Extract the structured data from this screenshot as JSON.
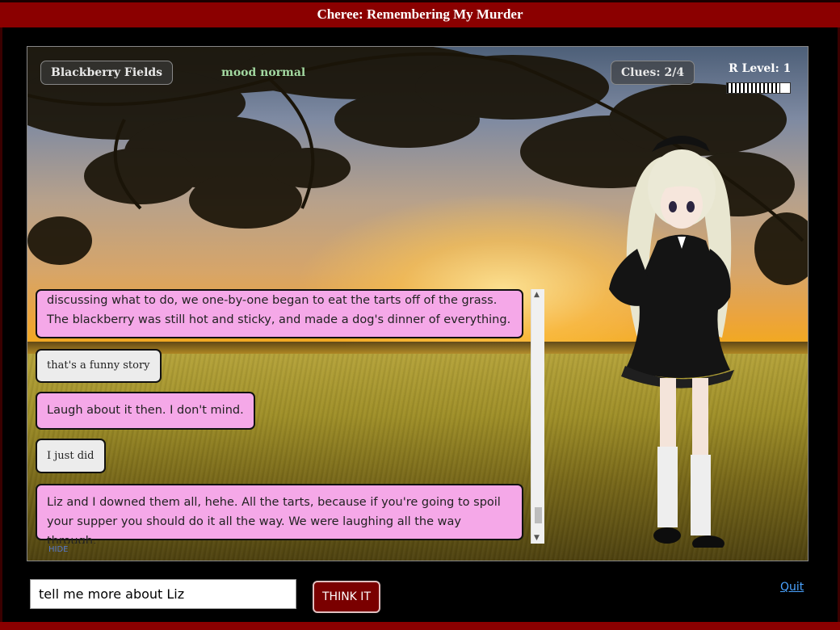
{
  "window": {
    "title": "Cheree: Remembering My Murder"
  },
  "scene": {
    "location": "Blackberry Fields",
    "mood": "mood normal",
    "clues_label": "Clues:",
    "clues_value": "2/4",
    "r_level_label": "R Level:",
    "r_level_value": "1",
    "r_level_meter_fraction": 0.84
  },
  "chat": {
    "messages": [
      {
        "from": "cheree",
        "text": "discussing what to do, we one-by-one began to eat the tarts off of the grass. The blackberry was still hot and sticky, and made a dog's dinner of everything."
      },
      {
        "from": "player",
        "text": "that's a funny story"
      },
      {
        "from": "cheree",
        "text": "Laugh about it then. I don't mind."
      },
      {
        "from": "player",
        "text": "I just did"
      },
      {
        "from": "cheree",
        "text": "Liz and I downed them all, hehe. All the tarts, because if you're going to spoil your supper you should do it all the way. We were laughing all the way through."
      }
    ],
    "hide_label": "HIDE",
    "scroll_up": "▲",
    "scroll_down": "▼"
  },
  "input": {
    "value": "tell me more about Liz"
  },
  "buttons": {
    "think": "THINK IT",
    "quit": "Quit"
  },
  "colors": {
    "title_bar": "#8b0000",
    "her_bubble": "#f5a8e8",
    "player_bubble": "#ececec",
    "think_button": "#7a0000",
    "mood_text": "#a3d9a1"
  }
}
